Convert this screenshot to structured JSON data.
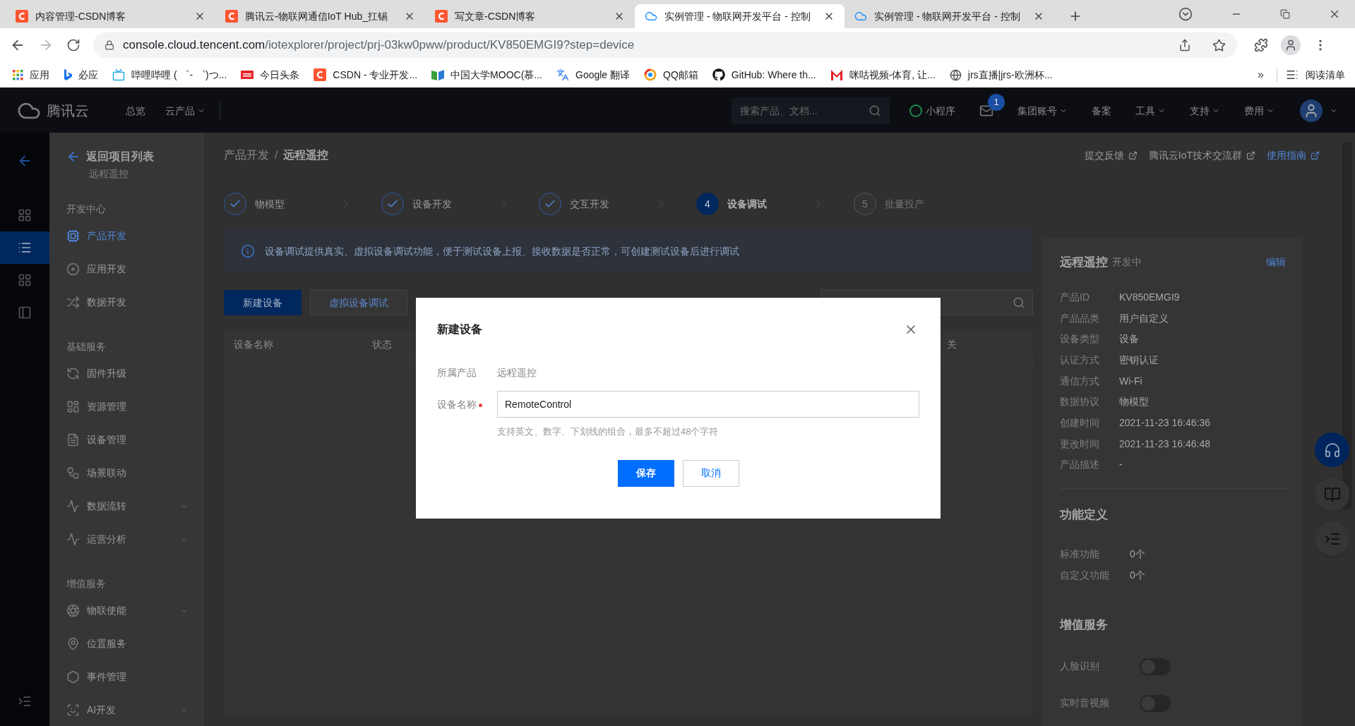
{
  "browser": {
    "tabs": [
      {
        "title": "内容管理-CSDN博客",
        "kind": "csdn",
        "selected": false
      },
      {
        "title": "腾讯云-物联网通信IoT Hub_扛锡",
        "kind": "csdn",
        "selected": false
      },
      {
        "title": "写文章-CSDN博客",
        "kind": "csdn",
        "selected": false
      },
      {
        "title": "实例管理 - 物联网开发平台 - 控制",
        "kind": "cloud",
        "selected": true
      },
      {
        "title": "实例管理 - 物联网开发平台 - 控制",
        "kind": "cloud",
        "selected": false
      }
    ],
    "url_host": "console.cloud.tencent.com",
    "url_path": "/iotexplorer/project/prj-03kw0pww/product/KV850EMGI9?step=device",
    "bookmarks": [
      {
        "label": "应用",
        "kind": "apps"
      },
      {
        "label": "必应",
        "kind": "bing"
      },
      {
        "label": "哔哩哔哩 ( ゜- ゜)つ...",
        "kind": "tv"
      },
      {
        "label": "今日头条",
        "kind": "news"
      },
      {
        "label": "CSDN - 专业开发...",
        "kind": "csdn"
      },
      {
        "label": "中国大学MOOC(慕...",
        "kind": "book"
      },
      {
        "label": "Google 翻译",
        "kind": "translate"
      },
      {
        "label": "QQ邮箱",
        "kind": "ring"
      },
      {
        "label": "GitHub: Where th...",
        "kind": "github"
      },
      {
        "label": "咪咕视频-体育, 让...",
        "kind": "migu"
      },
      {
        "label": "jrs直播|jrs-欧洲杯...",
        "kind": "globe"
      }
    ],
    "overflow": "»",
    "reading_list": "阅读清单"
  },
  "top_nav": {
    "brand": "腾讯云",
    "links": [
      {
        "label": "总览",
        "dropdown": false
      },
      {
        "label": "云产品",
        "dropdown": true
      }
    ],
    "search": {
      "placeholder": "搜索产品、文档..."
    },
    "mini_program": "小程序",
    "mail_badge": "1",
    "menus": [
      {
        "label": "集团账号",
        "dropdown": true
      },
      {
        "label": "备案",
        "dropdown": false
      },
      {
        "label": "工具",
        "dropdown": true
      },
      {
        "label": "支持",
        "dropdown": true
      },
      {
        "label": "费用",
        "dropdown": true
      }
    ]
  },
  "rail": {
    "items": [
      {
        "kind": "grid",
        "selected": false
      },
      {
        "kind": "list",
        "selected": true
      },
      {
        "kind": "grid",
        "selected": false
      },
      {
        "kind": "panel",
        "selected": false
      }
    ]
  },
  "sidebar": {
    "back": "返回项目列表",
    "project": "远程遥控",
    "sections": [
      {
        "title": "开发中心",
        "items": [
          {
            "label": "产品开发",
            "kind": "chip",
            "selected": true,
            "expandable": false
          },
          {
            "label": "应用开发",
            "kind": "disc",
            "selected": false,
            "expandable": false
          },
          {
            "label": "数据开发",
            "kind": "flow",
            "selected": false,
            "expandable": false
          }
        ]
      },
      {
        "title": "基础服务",
        "items": [
          {
            "label": "固件升级",
            "kind": "refresh",
            "selected": false,
            "expandable": false
          },
          {
            "label": "资源管理",
            "kind": "dashboard",
            "selected": false,
            "expandable": false
          },
          {
            "label": "设备管理",
            "kind": "doc",
            "selected": false,
            "expandable": false
          },
          {
            "label": "场景联动",
            "kind": "workflow",
            "selected": false,
            "expandable": false
          },
          {
            "label": "数据流转",
            "kind": "pulse",
            "selected": false,
            "expandable": true
          },
          {
            "label": "运营分析",
            "kind": "pulse",
            "selected": false,
            "expandable": true
          }
        ]
      },
      {
        "title": "增值服务",
        "items": [
          {
            "label": "物联使能",
            "kind": "aperture",
            "selected": false,
            "expandable": true
          },
          {
            "label": "位置服务",
            "kind": "pin",
            "selected": false,
            "expandable": false
          },
          {
            "label": "事件管理",
            "kind": "hexagon",
            "selected": false,
            "expandable": false
          },
          {
            "label": "AI开发",
            "kind": "face",
            "selected": false,
            "expandable": true
          }
        ]
      }
    ]
  },
  "breadcrumb": [
    "产品开发",
    "远程遥控"
  ],
  "breadcrumb_separator": "/",
  "header_links": [
    {
      "label": "提交反馈",
      "selected": false
    },
    {
      "label": "腾讯云IoT技术交流群",
      "selected": false
    },
    {
      "label": "使用指南",
      "selected": true
    }
  ],
  "steps": [
    {
      "label": "物模型",
      "kind": "done"
    },
    {
      "label": "设备开发",
      "kind": "done"
    },
    {
      "label": "交互开发",
      "kind": "done"
    },
    {
      "number": "4",
      "label": "设备调试",
      "kind": "current"
    },
    {
      "number": "5",
      "label": "批量投产",
      "kind": "pending"
    }
  ],
  "info": "设备调试提供真实、虚拟设备调试功能，便于测试设备上报、接收数据是否正常，可创建测试设备后进行调试",
  "toolbar": [
    {
      "label": "新建设备",
      "kind": "primary"
    },
    {
      "label": "虚拟设备调试",
      "kind": "secondary"
    }
  ],
  "table": {
    "columns": [
      "设备名称",
      "状态",
      "关"
    ]
  },
  "product_card": {
    "title": "远程遥控",
    "status": "开发中",
    "edit": "编辑",
    "fields": [
      {
        "label": "产品ID",
        "value": "KV850EMGI9"
      },
      {
        "label": "产品品类",
        "value": "用户自定义"
      },
      {
        "label": "设备类型",
        "value": "设备"
      },
      {
        "label": "认证方式",
        "value": "密钥认证"
      },
      {
        "label": "通信方式",
        "value": "Wi-Fi"
      },
      {
        "label": "数据协议",
        "value": "物模型"
      },
      {
        "label": "创建时间",
        "value": "2021-11-23 16:46:36"
      },
      {
        "label": "更改时间",
        "value": "2021-11-23 16:46:48"
      },
      {
        "label": "产品描述",
        "value": "-"
      }
    ],
    "functions_title": "功能定义",
    "functions": [
      {
        "label": "标准功能",
        "value": "0个"
      },
      {
        "label": "自定义功能",
        "value": "0个"
      }
    ],
    "services_title": "增值服务",
    "services": [
      {
        "label": "人脸识别",
        "on": false
      },
      {
        "label": "实时音视频",
        "on": false
      }
    ]
  },
  "dialog": {
    "title": "新建设备",
    "product_label": "所属产品",
    "product_value": "远程遥控",
    "name_label": "设备名称",
    "required": true,
    "name_value": "RemoteControl",
    "hint": "支持英文、数字、下划线的组合，最多不超过48个字符",
    "buttons": [
      {
        "label": "保存",
        "kind": "primary"
      },
      {
        "label": "取消",
        "kind": "secondary"
      }
    ]
  }
}
